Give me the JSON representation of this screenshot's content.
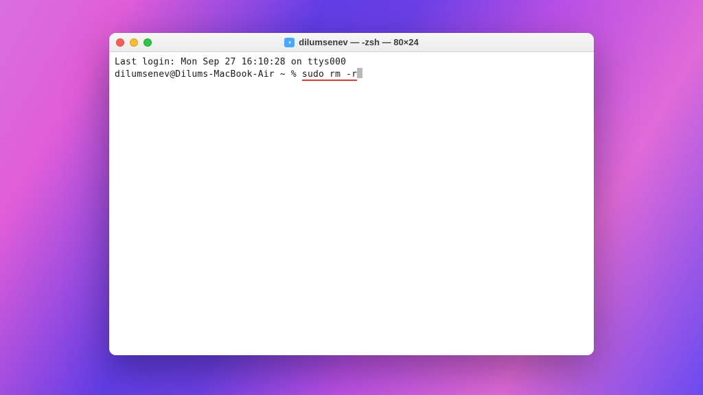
{
  "window": {
    "title": "dilumsenev — -zsh — 80×24"
  },
  "terminal": {
    "last_login": "Last login: Mon Sep 27 16:10:28 on ttys000",
    "prompt": "dilumsenev@Dilums-MacBook-Air ~ % ",
    "command": "sudo rm -r"
  }
}
